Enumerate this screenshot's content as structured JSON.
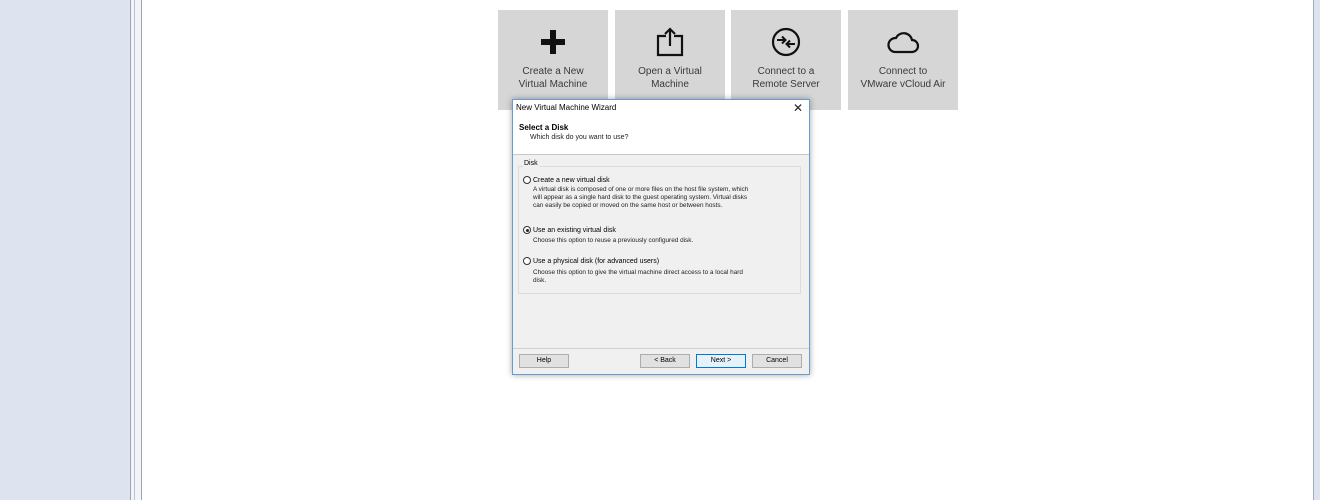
{
  "tiles": [
    {
      "line1": "Create a New",
      "line2": "Virtual Machine",
      "icon": "plus-icon"
    },
    {
      "line1": "Open a Virtual",
      "line2": "Machine",
      "icon": "open-folder-icon"
    },
    {
      "line1": "Connect to a",
      "line2": "Remote Server",
      "icon": "remote-server-icon"
    },
    {
      "line1": "Connect to",
      "line2": "VMware vCloud Air",
      "icon": "cloud-icon"
    }
  ],
  "dialog": {
    "title": "New Virtual Machine Wizard",
    "close_label": "✕",
    "heading": "Select a Disk",
    "subheading": "Which disk do you want to use?",
    "group_title": "Disk",
    "options": [
      {
        "label": "Create a new virtual disk",
        "checked": false,
        "desc": [
          "A virtual disk is composed of one or more files on the host file system, which",
          "will appear as a single hard disk to the guest operating system. Virtual disks",
          "can easily be copied or moved on the same host or between hosts."
        ]
      },
      {
        "label": "Use an existing virtual disk",
        "checked": true,
        "desc": [
          "Choose this option to reuse a previously configured disk."
        ]
      },
      {
        "label": "Use a physical disk (for advanced users)",
        "checked": false,
        "desc": [
          "Choose this option to give the virtual machine direct access to a local hard",
          "disk."
        ]
      }
    ],
    "buttons": {
      "help": "Help",
      "back": "< Back",
      "next": "Next >",
      "cancel": "Cancel"
    }
  }
}
